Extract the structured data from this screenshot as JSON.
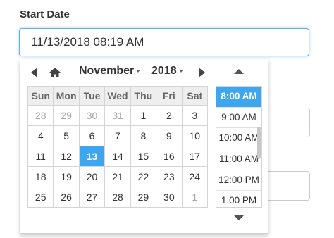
{
  "field": {
    "label": "Start Date",
    "value": "11/13/2018 08:19 AM"
  },
  "calendar": {
    "month": "November",
    "year": "2018",
    "weekdays": [
      "Sun",
      "Mon",
      "Tue",
      "Wed",
      "Thu",
      "Fri",
      "Sat"
    ],
    "weeks": [
      [
        {
          "d": "28",
          "m": true
        },
        {
          "d": "29",
          "m": true
        },
        {
          "d": "30",
          "m": true
        },
        {
          "d": "31",
          "m": true
        },
        {
          "d": "1"
        },
        {
          "d": "2"
        },
        {
          "d": "3"
        }
      ],
      [
        {
          "d": "4"
        },
        {
          "d": "5"
        },
        {
          "d": "6"
        },
        {
          "d": "7"
        },
        {
          "d": "8"
        },
        {
          "d": "9"
        },
        {
          "d": "10"
        }
      ],
      [
        {
          "d": "11"
        },
        {
          "d": "12"
        },
        {
          "d": "13",
          "s": true
        },
        {
          "d": "14"
        },
        {
          "d": "15"
        },
        {
          "d": "16"
        },
        {
          "d": "17"
        }
      ],
      [
        {
          "d": "18"
        },
        {
          "d": "19"
        },
        {
          "d": "20"
        },
        {
          "d": "21"
        },
        {
          "d": "22"
        },
        {
          "d": "23"
        },
        {
          "d": "24"
        }
      ],
      [
        {
          "d": "25"
        },
        {
          "d": "26"
        },
        {
          "d": "27"
        },
        {
          "d": "28"
        },
        {
          "d": "29"
        },
        {
          "d": "30"
        },
        {
          "d": "1",
          "m": true
        }
      ]
    ]
  },
  "times": {
    "selected": "8:00 AM",
    "items": [
      "8:00 AM",
      "9:00 AM",
      "10:00 AM",
      "11:00 AM",
      "12:00 PM",
      "1:00 PM"
    ]
  },
  "icons": {
    "prev": "triangle-left-icon",
    "home": "home-icon",
    "next": "triangle-right-icon",
    "up": "triangle-up-icon",
    "down": "triangle-down-icon"
  },
  "colors": {
    "accent": "#3ea6ef",
    "focus_border": "#66afe9",
    "muted_text": "#a6a6a6"
  }
}
